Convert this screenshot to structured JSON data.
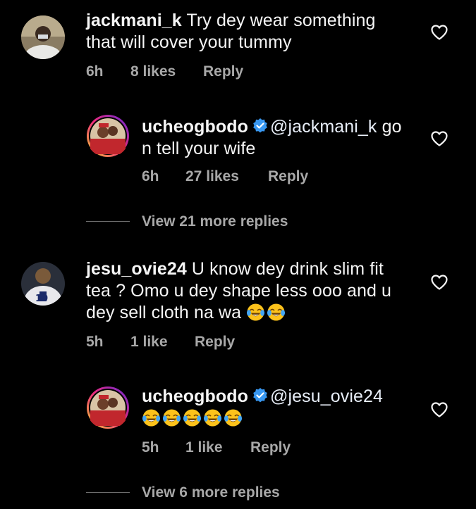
{
  "comments": [
    {
      "username": "jackmani_k",
      "text_line1": "Try dey wear something",
      "text_line2": "that will cover your tummy",
      "time": "6h",
      "likes": "8 likes",
      "reply": "Reply"
    },
    {
      "username": "ucheogbodo",
      "mention": "@jackmani_k",
      "text_line1_rest": "go",
      "text_line2": "n tell your wife",
      "time": "6h",
      "likes": "27 likes",
      "reply": "Reply",
      "verified": true
    },
    {
      "view_more": "View 21 more replies"
    },
    {
      "username": "jesu_ovie24",
      "text_line1": "U know dey drink slim fit",
      "text_line2": "tea ? Omo u dey shape less ooo and u",
      "text_line3": "dey sell cloth na wa",
      "emoji_name": "face-with-tears-of-joy",
      "time": "5h",
      "likes": "1 like",
      "reply": "Reply"
    },
    {
      "username": "ucheogbodo",
      "mention": "@jesu_ovie24",
      "emoji_name": "face-with-tears-of-joy",
      "time": "5h",
      "likes": "1 like",
      "reply": "Reply",
      "verified": true
    },
    {
      "view_more": "View 6 more replies"
    }
  ],
  "colors": {
    "background": "#000000",
    "text": "#f5f5f5",
    "meta": "#a8a8a8",
    "verified": "#3897f0"
  }
}
